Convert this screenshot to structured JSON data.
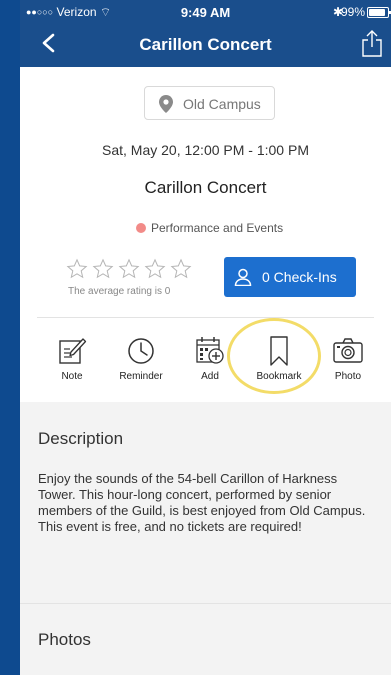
{
  "status_bar": {
    "carrier": "Verizon",
    "time": "9:49 AM",
    "battery": "99%"
  },
  "nav": {
    "title": "Carillon Concert",
    "back_icon": "chevron-left-icon",
    "share_icon": "share-icon"
  },
  "event": {
    "location": "Old Campus",
    "datetime": "Sat, May 20, 12:00 PM - 1:00 PM",
    "title": "Carillon Concert",
    "category": "Performance and Events",
    "category_color": "#f28b88",
    "rating": 0,
    "rating_max": 5,
    "rating_text": "The average rating is 0",
    "checkins_label": "0 Check-Ins"
  },
  "actions": [
    {
      "label": "Note",
      "icon": "note-icon"
    },
    {
      "label": "Reminder",
      "icon": "clock-icon"
    },
    {
      "label": "Add",
      "icon": "calendar-add-icon"
    },
    {
      "label": "Bookmark",
      "icon": "bookmark-icon"
    },
    {
      "label": "Photo",
      "icon": "camera-icon"
    }
  ],
  "description": {
    "heading": "Description",
    "body": "Enjoy the sounds of the 54-bell Carillon of Harkness Tower. This hour-long concert, performed by senior members of the Guild, is best enjoyed from Old Campus. This event is free, and no tickets are required!"
  },
  "photos": {
    "heading": "Photos"
  },
  "colors": {
    "nav_bar": "#1a4e8c",
    "checkin_button": "#1d6fcf",
    "highlight": "#f3dc68",
    "background": "#0e4a8f"
  }
}
